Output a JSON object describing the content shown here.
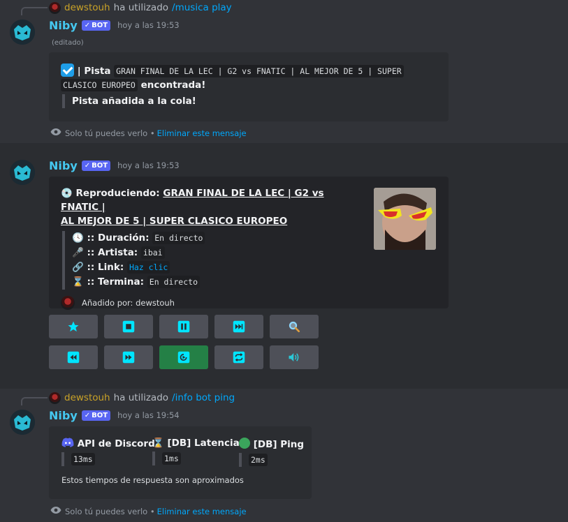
{
  "messages": [
    {
      "reply": {
        "user": "dewstouh",
        "text": "ha utilizado",
        "command": "/musica play"
      },
      "author": "Niby",
      "badge": "BOT",
      "time": "hoy a las 19:53",
      "edited": "(editado)",
      "embed": {
        "prefix": "| Pista",
        "track_code": "GRAN FINAL DE LA LEC | G2 vs FNATIC | AL MEJOR DE 5 | SUPER",
        "track_code2": "CLASICO EUROPEO",
        "suffix": "encontrada!",
        "quote": "Pista añadida a la cola!"
      },
      "ephemeral": {
        "text": "Solo tú puedes verlo •",
        "link": "Eliminar este mensaje"
      }
    },
    {
      "author": "Niby",
      "badge": "BOT",
      "time": "hoy a las 19:53",
      "embed": {
        "playing_label": "Reproduciendo:",
        "title_line1": "GRAN FINAL DE LA LEC | G2 vs FNATIC |",
        "title_line2": "AL MEJOR DE 5 | SUPER CLASICO EUROPEO",
        "fields": [
          {
            "icon": "🕓",
            "label": ":: Duración:",
            "value": "En directo"
          },
          {
            "icon": "🎤",
            "label": ":: Artista:",
            "value": "ibai"
          },
          {
            "icon": "🔗",
            "label": ":: Link:",
            "value": "Haz clic"
          },
          {
            "icon": "⌛",
            "label": ":: Termina:",
            "value": "En directo"
          }
        ],
        "footer": "Añadido por: dewstouh"
      },
      "buttons": [
        {
          "icon": "star-icon",
          "glyph": "★"
        },
        {
          "icon": "stop-icon",
          "glyph": "■"
        },
        {
          "icon": "pause-icon",
          "glyph": "⏸"
        },
        {
          "icon": "skip-icon",
          "glyph": "⏭"
        },
        {
          "icon": "search-icon",
          "glyph": "🔍"
        },
        {
          "icon": "rewind-icon",
          "glyph": "⏪"
        },
        {
          "icon": "fast-forward-icon",
          "glyph": "⏩"
        },
        {
          "icon": "autoplay-icon",
          "glyph": "▶"
        },
        {
          "icon": "loop-icon",
          "glyph": "🔁"
        },
        {
          "icon": "volume-icon",
          "glyph": "🔊"
        }
      ]
    },
    {
      "reply": {
        "user": "dewstouh",
        "text": "ha utilizado",
        "command": "/info bot ping"
      },
      "author": "Niby",
      "badge": "BOT",
      "time": "hoy a las 19:54",
      "embed": {
        "fields": [
          {
            "name": "API de Discord",
            "value": "13ms"
          },
          {
            "name": "[DB] Latencia",
            "value": "1ms"
          },
          {
            "name": "[DB] Ping",
            "value": "2ms"
          }
        ],
        "note": "Estos tiempos de respuesta son aproximados"
      },
      "ephemeral": {
        "text": "Solo tú puedes verlo •",
        "link": "Eliminar este mensaje"
      }
    }
  ],
  "colors": {
    "accent": "#00a8fc",
    "username": "#45c8f0",
    "bot_badge": "#5865f2",
    "button": "#4e5058",
    "button_green": "#248046",
    "icon_cyan": "#00e5ff"
  }
}
